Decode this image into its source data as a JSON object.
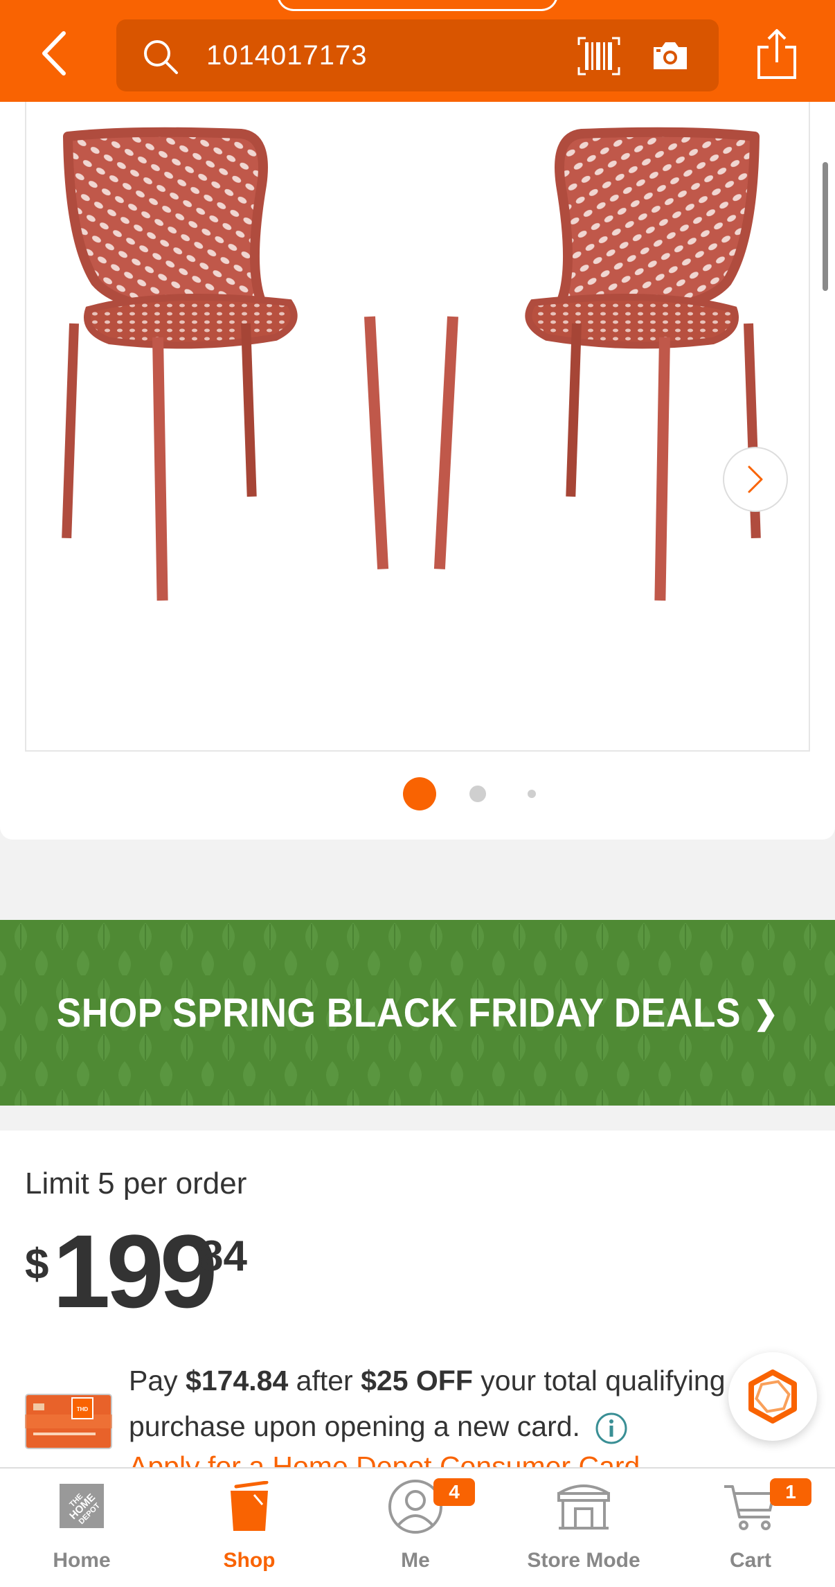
{
  "header": {
    "search_value": "1014017173",
    "back_icon": "chevron-left-icon",
    "search_icon": "search-icon",
    "barcode_icon": "barcode-icon",
    "camera_icon": "camera-icon",
    "share_icon": "share-icon",
    "background": "#f96302"
  },
  "gallery": {
    "image_subject": "two red outdoor stacking chairs",
    "chair_color": "#c0584a",
    "total_images": 3,
    "current_image": 1,
    "next_icon": "chevron-right-icon"
  },
  "banner": {
    "text": "SHOP SPRING BLACK FRIDAY DEALS",
    "arrow": "❯",
    "background": "#4f8a34"
  },
  "pricing": {
    "limit": "Limit 5 per order",
    "currency": "$",
    "dollars": "199",
    "cents": "84",
    "promo_prefix": "Pay ",
    "promo_amount": "$174.84",
    "promo_mid": " after ",
    "promo_discount": "$25 OFF",
    "promo_suffix": " your total qualifying",
    "promo_line2": "purchase upon opening a new card.",
    "apply_link": "Apply for a Home Depot Consumer Card"
  },
  "chat": {
    "icon": "chat-hexagon-icon"
  },
  "nav": {
    "items": [
      {
        "label": "Home",
        "icon": "home-depot-logo-icon"
      },
      {
        "label": "Shop",
        "icon": "shop-bucket-icon",
        "active": true
      },
      {
        "label": "Me",
        "icon": "user-icon",
        "badge": "4"
      },
      {
        "label": "Store Mode",
        "icon": "store-icon"
      },
      {
        "label": "Cart",
        "icon": "cart-icon",
        "badge": "1"
      }
    ]
  },
  "colors": {
    "accent": "#f96302",
    "text": "#333333",
    "muted": "#888888"
  }
}
